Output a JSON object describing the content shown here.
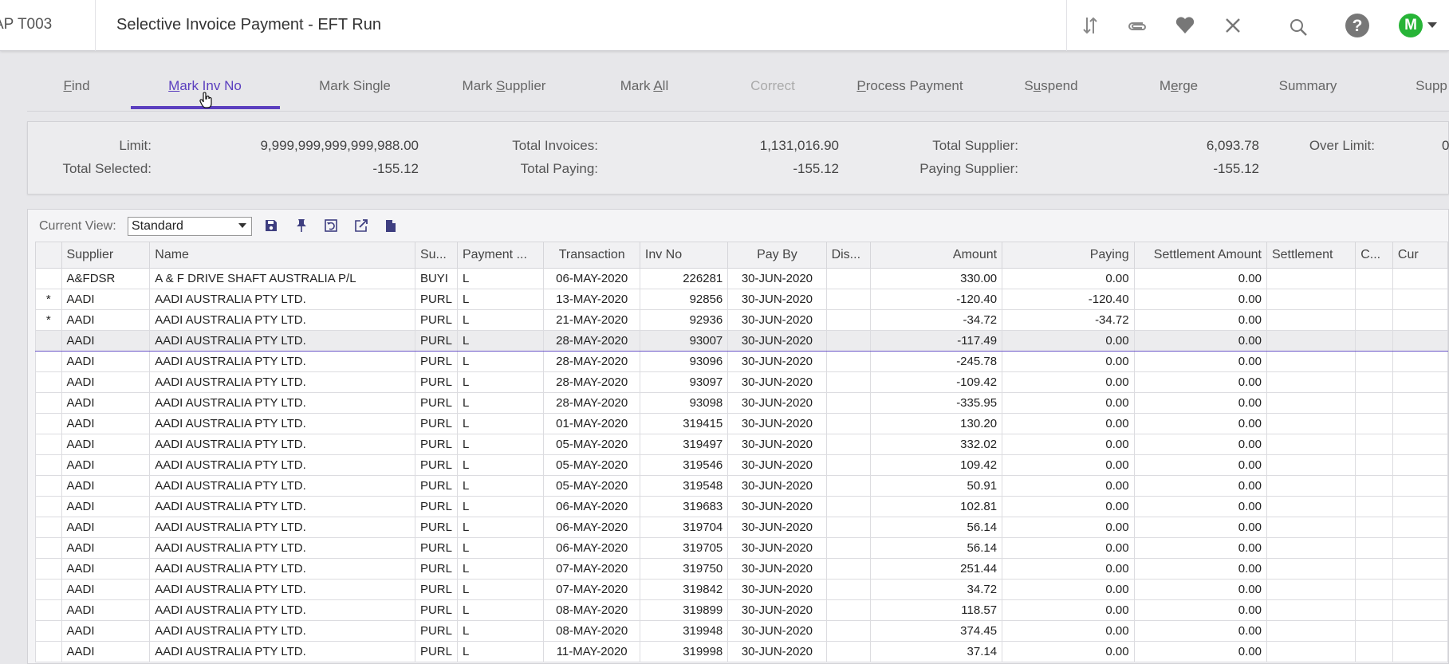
{
  "header": {
    "app_code": "AP T003",
    "title": "Selective Invoice Payment - EFT Run",
    "avatar_initial": "M",
    "icons": [
      "sort-arrows-icon",
      "paperclip-icon",
      "heart-icon",
      "close-icon",
      "search-icon",
      "help-icon"
    ]
  },
  "tabs": [
    {
      "pre": "",
      "ul": "F",
      "post": "ind",
      "state": "normal"
    },
    {
      "pre": "",
      "ul": "M",
      "post": "ark Inv No",
      "state": "active"
    },
    {
      "pre": "Mark Single",
      "ul": "",
      "post": "",
      "state": "normal"
    },
    {
      "pre": "Mark ",
      "ul": "S",
      "post": "upplier",
      "state": "normal"
    },
    {
      "pre": "Mark ",
      "ul": "A",
      "post": "ll",
      "state": "normal"
    },
    {
      "pre": "Correct",
      "ul": "",
      "post": "",
      "state": "disabled"
    },
    {
      "pre": "",
      "ul": "P",
      "post": "rocess Payment",
      "state": "normal"
    },
    {
      "pre": "S",
      "ul": "u",
      "post": "spend",
      "state": "normal"
    },
    {
      "pre": "M",
      "ul": "e",
      "post": "rge",
      "state": "normal"
    },
    {
      "pre": "Summary",
      "ul": "",
      "post": "",
      "state": "normal"
    },
    {
      "pre": "Supp",
      "ul": "",
      "post": "",
      "state": "normal"
    }
  ],
  "summary": {
    "limit_label": "Limit:",
    "limit_value": "9,999,999,999,999,988.00",
    "total_selected_label": "Total Selected:",
    "total_selected_value": "-155.12",
    "total_invoices_label": "Total Invoices:",
    "total_invoices_value": "1,131,016.90",
    "total_paying_label": "Total Paying:",
    "total_paying_value": "-155.12",
    "total_supplier_label": "Total Supplier:",
    "total_supplier_value": "6,093.78",
    "paying_supplier_label": "Paying Supplier:",
    "paying_supplier_value": "-155.12",
    "over_limit_label": "Over Limit:",
    "over_limit_value": "0"
  },
  "view": {
    "label": "Current View:",
    "selected": "Standard",
    "tools": [
      "save-icon",
      "pin-icon",
      "reset-view-icon",
      "export-icon",
      "document-icon"
    ]
  },
  "grid": {
    "columns": [
      "",
      "Supplier",
      "Name",
      "Su...",
      "Payment ...",
      "Transaction",
      "Inv No",
      "Pay By",
      "Dis...",
      "Amount",
      "Paying",
      "Settlement Amount",
      "Settlement",
      "C...",
      "Cur"
    ],
    "rows": [
      [
        "",
        "A&FDSR",
        "A & F DRIVE SHAFT AUSTRALIA P/L",
        "BUYI",
        "L",
        "06-MAY-2020",
        "226281",
        "30-JUN-2020",
        "",
        "330.00",
        "0.00",
        "0.00",
        "",
        "",
        ""
      ],
      [
        "*",
        "AADI",
        "AADI  AUSTRALIA  PTY LTD.",
        "PURL",
        "L",
        "13-MAY-2020",
        "92856",
        "30-JUN-2020",
        "",
        "-120.40",
        "-120.40",
        "0.00",
        "",
        "",
        ""
      ],
      [
        "*",
        "AADI",
        "AADI  AUSTRALIA  PTY LTD.",
        "PURL",
        "L",
        "21-MAY-2020",
        "92936",
        "30-JUN-2020",
        "",
        "-34.72",
        "-34.72",
        "0.00",
        "",
        "",
        ""
      ],
      [
        "",
        "AADI",
        "AADI  AUSTRALIA  PTY LTD.",
        "PURL",
        "L",
        "28-MAY-2020",
        "93007",
        "30-JUN-2020",
        "",
        "-117.49",
        "0.00",
        "0.00",
        "",
        "",
        ""
      ],
      [
        "",
        "AADI",
        "AADI  AUSTRALIA  PTY LTD.",
        "PURL",
        "L",
        "28-MAY-2020",
        "93096",
        "30-JUN-2020",
        "",
        "-245.78",
        "0.00",
        "0.00",
        "",
        "",
        ""
      ],
      [
        "",
        "AADI",
        "AADI  AUSTRALIA  PTY LTD.",
        "PURL",
        "L",
        "28-MAY-2020",
        "93097",
        "30-JUN-2020",
        "",
        "-109.42",
        "0.00",
        "0.00",
        "",
        "",
        ""
      ],
      [
        "",
        "AADI",
        "AADI  AUSTRALIA  PTY LTD.",
        "PURL",
        "L",
        "28-MAY-2020",
        "93098",
        "30-JUN-2020",
        "",
        "-335.95",
        "0.00",
        "0.00",
        "",
        "",
        ""
      ],
      [
        "",
        "AADI",
        "AADI  AUSTRALIA  PTY LTD.",
        "PURL",
        "L",
        "01-MAY-2020",
        "319415",
        "30-JUN-2020",
        "",
        "130.20",
        "0.00",
        "0.00",
        "",
        "",
        ""
      ],
      [
        "",
        "AADI",
        "AADI  AUSTRALIA  PTY LTD.",
        "PURL",
        "L",
        "05-MAY-2020",
        "319497",
        "30-JUN-2020",
        "",
        "332.02",
        "0.00",
        "0.00",
        "",
        "",
        ""
      ],
      [
        "",
        "AADI",
        "AADI  AUSTRALIA  PTY LTD.",
        "PURL",
        "L",
        "05-MAY-2020",
        "319546",
        "30-JUN-2020",
        "",
        "109.42",
        "0.00",
        "0.00",
        "",
        "",
        ""
      ],
      [
        "",
        "AADI",
        "AADI  AUSTRALIA  PTY LTD.",
        "PURL",
        "L",
        "05-MAY-2020",
        "319548",
        "30-JUN-2020",
        "",
        "50.91",
        "0.00",
        "0.00",
        "",
        "",
        ""
      ],
      [
        "",
        "AADI",
        "AADI  AUSTRALIA  PTY LTD.",
        "PURL",
        "L",
        "06-MAY-2020",
        "319683",
        "30-JUN-2020",
        "",
        "102.81",
        "0.00",
        "0.00",
        "",
        "",
        ""
      ],
      [
        "",
        "AADI",
        "AADI  AUSTRALIA  PTY LTD.",
        "PURL",
        "L",
        "06-MAY-2020",
        "319704",
        "30-JUN-2020",
        "",
        "56.14",
        "0.00",
        "0.00",
        "",
        "",
        ""
      ],
      [
        "",
        "AADI",
        "AADI  AUSTRALIA  PTY LTD.",
        "PURL",
        "L",
        "06-MAY-2020",
        "319705",
        "30-JUN-2020",
        "",
        "56.14",
        "0.00",
        "0.00",
        "",
        "",
        ""
      ],
      [
        "",
        "AADI",
        "AADI  AUSTRALIA  PTY LTD.",
        "PURL",
        "L",
        "07-MAY-2020",
        "319750",
        "30-JUN-2020",
        "",
        "251.44",
        "0.00",
        "0.00",
        "",
        "",
        ""
      ],
      [
        "",
        "AADI",
        "AADI  AUSTRALIA  PTY LTD.",
        "PURL",
        "L",
        "07-MAY-2020",
        "319842",
        "30-JUN-2020",
        "",
        "34.72",
        "0.00",
        "0.00",
        "",
        "",
        ""
      ],
      [
        "",
        "AADI",
        "AADI  AUSTRALIA  PTY LTD.",
        "PURL",
        "L",
        "08-MAY-2020",
        "319899",
        "30-JUN-2020",
        "",
        "118.57",
        "0.00",
        "0.00",
        "",
        "",
        ""
      ],
      [
        "",
        "AADI",
        "AADI  AUSTRALIA  PTY LTD.",
        "PURL",
        "L",
        "08-MAY-2020",
        "319948",
        "30-JUN-2020",
        "",
        "374.45",
        "0.00",
        "0.00",
        "",
        "",
        ""
      ],
      [
        "",
        "AADI",
        "AADI  AUSTRALIA  PTY LTD.",
        "PURL",
        "L",
        "11-MAY-2020",
        "319998",
        "30-JUN-2020",
        "",
        "37.14",
        "0.00",
        "0.00",
        "",
        "",
        ""
      ]
    ],
    "selected_row": 3
  },
  "colors": {
    "accent": "#5b3fbf",
    "avatar": "#27b437"
  }
}
